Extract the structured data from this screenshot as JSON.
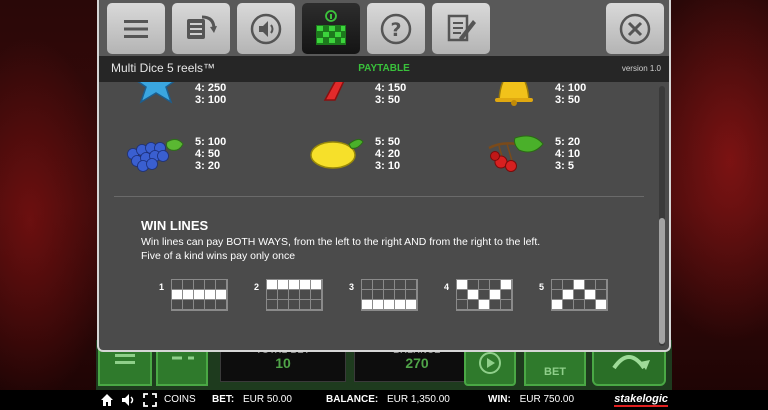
{
  "toolbar": {
    "buttons": [
      {
        "name": "menu-icon"
      },
      {
        "name": "autoplay-settings-icon"
      },
      {
        "name": "sound-icon"
      },
      {
        "name": "paytable-icon",
        "active": true
      },
      {
        "name": "help-icon"
      },
      {
        "name": "notes-icon"
      },
      {
        "name": "close-icon"
      }
    ]
  },
  "titlebar": {
    "game_title": "Multi Dice 5 reels™",
    "section": "PAYTABLE",
    "version": "version 1.0"
  },
  "paytable": {
    "rows": [
      [
        {
          "symbol": "star-icon",
          "lines": [
            "4: 250",
            "3: 100"
          ]
        },
        {
          "symbol": "seven-icon",
          "lines": [
            "4: 150",
            "3: 50"
          ]
        },
        {
          "symbol": "bell-icon",
          "lines": [
            "4: 100",
            "3: 50"
          ]
        }
      ],
      [
        {
          "symbol": "grapes-icon",
          "lines": [
            "5: 100",
            "4: 50",
            "3: 20"
          ]
        },
        {
          "symbol": "lemon-icon",
          "lines": [
            "5: 50",
            "4: 20",
            "3: 10"
          ]
        },
        {
          "symbol": "cherries-icon",
          "lines": [
            "5: 20",
            "4: 10",
            "3: 5"
          ]
        }
      ]
    ]
  },
  "win_lines": {
    "title": "WIN LINES",
    "text1": "Win lines can pay BOTH WAYS, from the left to the right AND from the right to the left.",
    "text2": "Five of a kind wins pay only once",
    "lines": [
      {
        "num": "1",
        "rows": [
          0,
          0,
          0,
          0,
          0,
          1,
          1,
          1,
          1,
          1,
          0,
          0,
          0,
          0,
          0
        ]
      },
      {
        "num": "2",
        "rows": [
          1,
          1,
          1,
          1,
          1,
          0,
          0,
          0,
          0,
          0,
          0,
          0,
          0,
          0,
          0
        ]
      },
      {
        "num": "3",
        "rows": [
          0,
          0,
          0,
          0,
          0,
          0,
          0,
          0,
          0,
          0,
          1,
          1,
          1,
          1,
          1
        ]
      },
      {
        "num": "4",
        "rows": [
          1,
          0,
          0,
          0,
          1,
          0,
          1,
          0,
          1,
          0,
          0,
          0,
          1,
          0,
          0
        ]
      },
      {
        "num": "5",
        "rows": [
          0,
          0,
          1,
          0,
          0,
          0,
          1,
          0,
          1,
          0,
          1,
          0,
          0,
          0,
          1
        ]
      }
    ]
  },
  "game_behind": {
    "total_bet_label": "TOTAL BET",
    "total_bet_value": "10",
    "balance_label": "BALANCE",
    "balance_value": "270",
    "bet_button_label": "BET"
  },
  "bottombar": {
    "coins_label": "COINS",
    "bet_label": "BET:",
    "bet_value": "EUR 50.00",
    "balance_label": "BALANCE:",
    "balance_value": "EUR 1,350.00",
    "win_label": "WIN:",
    "win_value": "EUR 750.00",
    "brand": "stakelogic"
  },
  "colors": {
    "accent_green": "#39c13b",
    "panel": "#4b4b4b",
    "titlebar": "#262626"
  }
}
